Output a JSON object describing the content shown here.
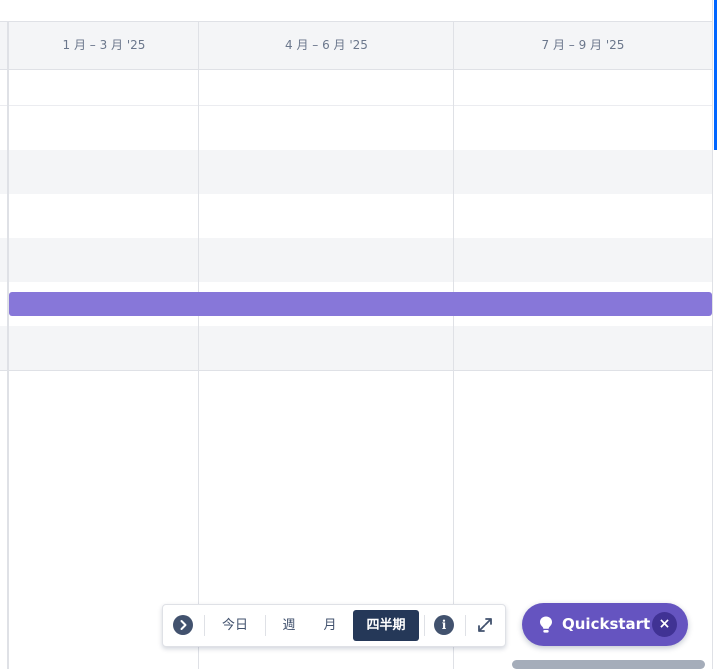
{
  "timeline": {
    "columns": [
      {
        "label": "1 月 – 3 月 '25"
      },
      {
        "label": "4 月 – 6 月 '25"
      },
      {
        "label": "7 月 – 9 月 '25"
      }
    ]
  },
  "toolbar": {
    "collapse_icon": "chevron-right-icon",
    "today_label": "今日",
    "week_label": "週",
    "month_label": "月",
    "quarter_label": "四半期",
    "active_view": "四半期",
    "info_icon": "info-icon",
    "expand_icon": "expand-icon"
  },
  "quickstart": {
    "label": "Quickstart",
    "icon": "lightbulb-icon",
    "close_icon": "close-icon"
  },
  "colors": {
    "bar": "#8777d9",
    "quickstart_bg": "#6554c0",
    "toolbar_active": "#253858",
    "accent": "#0065ff"
  }
}
